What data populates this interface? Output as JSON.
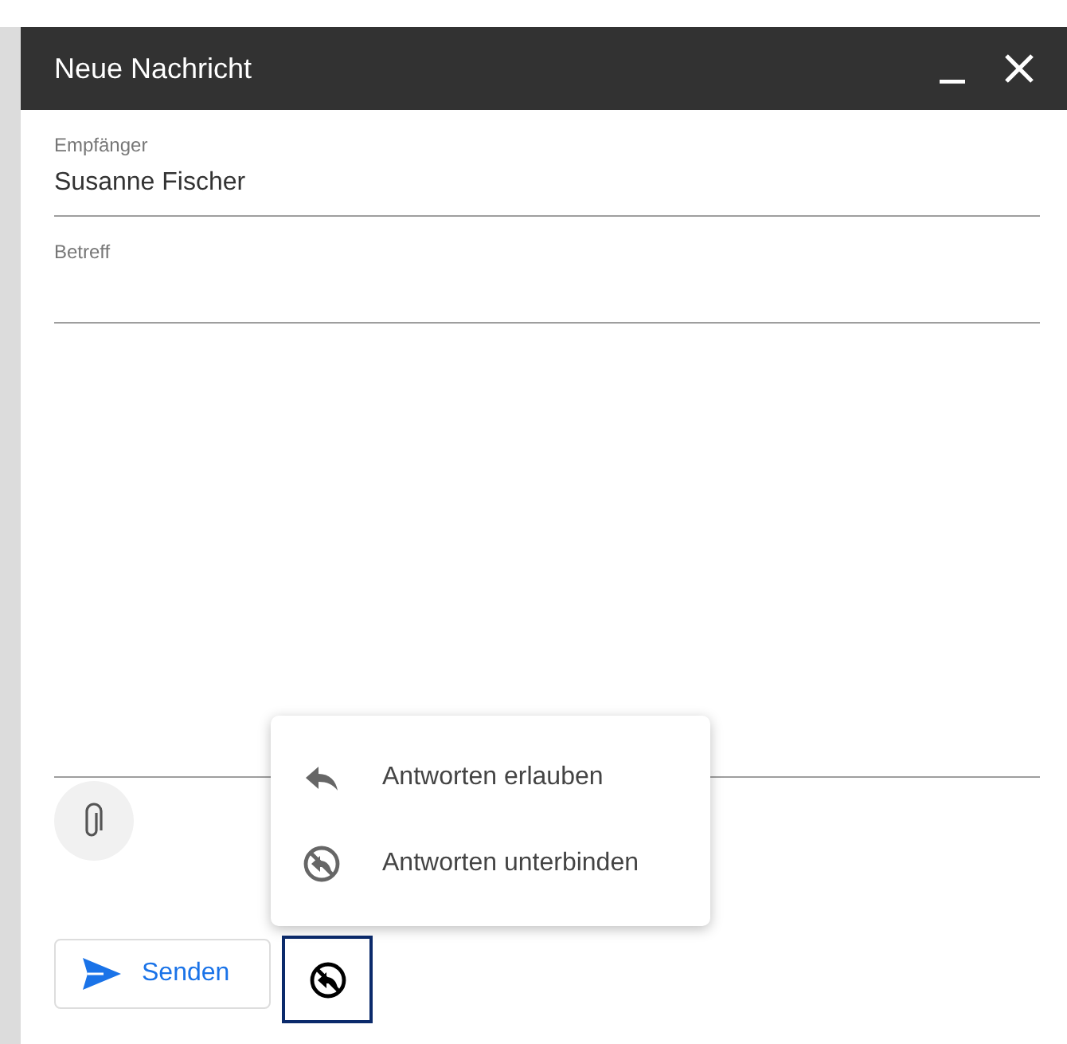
{
  "window": {
    "title": "Neue Nachricht"
  },
  "fields": [
    {
      "label": "Empfänger",
      "value": "Susanne Fischer"
    },
    {
      "label": "Betreff"
    }
  ],
  "reply_menu": {
    "open": true,
    "items": [
      {
        "label": "Antworten erlauben",
        "kind": "allow"
      },
      {
        "label": "Antworten unterbinden",
        "kind": "block"
      }
    ]
  },
  "send_button": {
    "label": "Senden"
  },
  "reply_toggle": {
    "kind": "block",
    "focused": true
  }
}
